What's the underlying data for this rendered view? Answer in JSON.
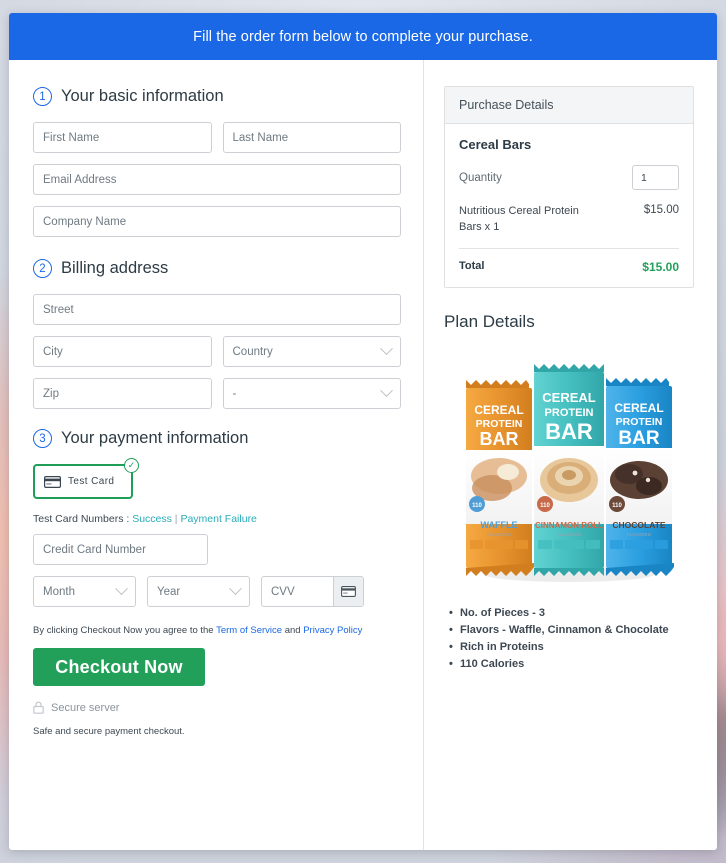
{
  "banner": {
    "text": "Fill the order form below to complete your purchase."
  },
  "sections": {
    "basic": {
      "num": "1",
      "title": "Your basic information"
    },
    "billing": {
      "num": "2",
      "title": "Billing address"
    },
    "payment": {
      "num": "3",
      "title": "Your payment information"
    }
  },
  "fields": {
    "first_name": "First Name",
    "last_name": "Last Name",
    "email": "Email Address",
    "company": "Company Name",
    "street": "Street",
    "city": "City",
    "country": "Country",
    "zip": "Zip",
    "state": "-",
    "card_number": "Credit Card Number",
    "month": "Month",
    "year": "Year",
    "cvv": "CVV"
  },
  "payment": {
    "test_card_label": "Test  Card",
    "card_icon": "credit-card-icon",
    "check_icon": "✓",
    "test_numbers_prefix": "Test Card Numbers : ",
    "success_link": "Success",
    "separator": " | ",
    "failure_link": "Payment Failure"
  },
  "footer": {
    "terms_prefix": "By clicking Checkout Now you agree to the ",
    "terms_link": "Term of Service",
    "terms_middle": " and ",
    "privacy_link": "Privacy Policy",
    "checkout_button": "Checkout Now",
    "lock_icon": "lock-icon",
    "secure_server": "Secure server",
    "safe_note": "Safe and secure payment checkout."
  },
  "purchase": {
    "header": "Purchase Details",
    "product_name": "Cereal Bars",
    "quantity_label": "Quantity",
    "quantity_value": "1",
    "line_item_desc": "Nutritious Cereal Protein Bars x 1",
    "line_item_amount": "$15.00",
    "total_label": "Total",
    "total_amount": "$15.00"
  },
  "plan": {
    "title": "Plan Details",
    "features": [
      "No. of Pieces - 3",
      "Flavors - Waffle, Cinnamon & Chocolate",
      "Rich in Proteins",
      "110 Calories"
    ],
    "product_bars": [
      {
        "flavor": "WAFFLE",
        "sub": "FLAVORED",
        "color": "#E8942E",
        "calories": "110"
      },
      {
        "flavor": "CINNAMON ROLL",
        "sub": "FLAVORED",
        "color": "#45BFC0",
        "calories": "110"
      },
      {
        "flavor": "CHOCOLATE",
        "sub": "FLAVORED",
        "color": "#2B9FE0",
        "calories": "110"
      }
    ],
    "bar_title_line1": "CEREAL",
    "bar_title_line2": "PROTEIN",
    "bar_title_line3": "BAR"
  },
  "colors": {
    "banner_blue": "#1a68e5",
    "accent_green": "#22a05a",
    "link_teal": "#2aacb8",
    "link_blue": "#1a68e5"
  }
}
